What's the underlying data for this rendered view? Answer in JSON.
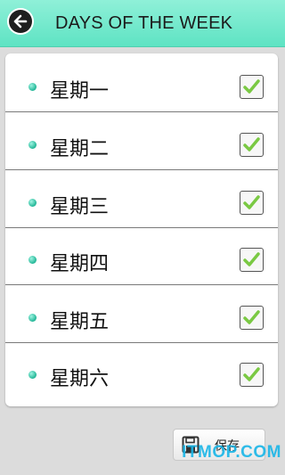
{
  "header": {
    "title": "DAYS OF THE WEEK",
    "back_icon": "arrow-left-icon"
  },
  "days": [
    {
      "label": "星期一",
      "checked": true
    },
    {
      "label": "星期二",
      "checked": true
    },
    {
      "label": "星期三",
      "checked": true
    },
    {
      "label": "星期四",
      "checked": true
    },
    {
      "label": "星期五",
      "checked": true
    },
    {
      "label": "星期六",
      "checked": true
    }
  ],
  "footer": {
    "save_label": "保存",
    "save_icon": "floppy-disk-icon"
  },
  "watermark": "ITMOP.COM",
  "colors": {
    "header": "#6ee8ca",
    "accent_dot": "#21b596",
    "check": "#7ac943",
    "watermark": "#19b6e8"
  }
}
